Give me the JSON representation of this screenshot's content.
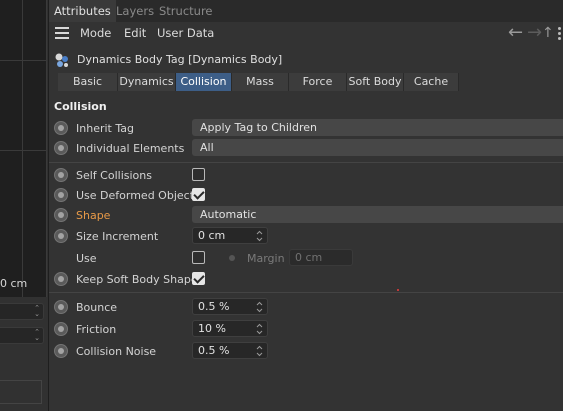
{
  "left": {
    "value_text": "0 cm"
  },
  "tabs": [
    {
      "label": "Attributes",
      "active": true
    },
    {
      "label": "Layers",
      "active": false
    },
    {
      "label": "Structure",
      "active": false
    }
  ],
  "menu": {
    "mode": "Mode",
    "edit": "Edit",
    "user_data": "User Data"
  },
  "object": {
    "title": "Dynamics Body Tag [Dynamics Body]",
    "icon": "dynamics-body-tag-icon"
  },
  "subtabs": [
    {
      "label": "Basic",
      "active": false
    },
    {
      "label": "Dynamics",
      "active": false
    },
    {
      "label": "Collision",
      "active": true
    },
    {
      "label": "Mass",
      "active": false
    },
    {
      "label": "Force",
      "active": false
    },
    {
      "label": "Soft Body",
      "active": false
    },
    {
      "label": "Cache",
      "active": false
    }
  ],
  "section": {
    "title": "Collision"
  },
  "fields": {
    "inherit_tag": {
      "label": "Inherit Tag",
      "value": "Apply Tag to Children"
    },
    "individual_elements": {
      "label": "Individual Elements",
      "value": "All"
    },
    "self_collisions": {
      "label": "Self Collisions",
      "checked": false
    },
    "use_deformed_object": {
      "label": "Use Deformed Object",
      "checked": true
    },
    "shape": {
      "label": "Shape",
      "value": "Automatic"
    },
    "size_increment": {
      "label": "Size Increment",
      "value": "0 cm"
    },
    "use": {
      "label": "Use",
      "checked": false
    },
    "margin": {
      "label": "Margin",
      "value": "0 cm"
    },
    "keep_soft_body_shape": {
      "label": "Keep Soft Body Shape",
      "checked": true
    },
    "bounce": {
      "label": "Bounce",
      "value": "0.5 %"
    },
    "friction": {
      "label": "Friction",
      "value": "10 %"
    },
    "collision_noise": {
      "label": "Collision Noise",
      "value": "0.5 %"
    }
  },
  "colors": {
    "active_tab": "#3d5e87",
    "highlight_label": "#e89a48",
    "panel_bg": "#333333"
  }
}
